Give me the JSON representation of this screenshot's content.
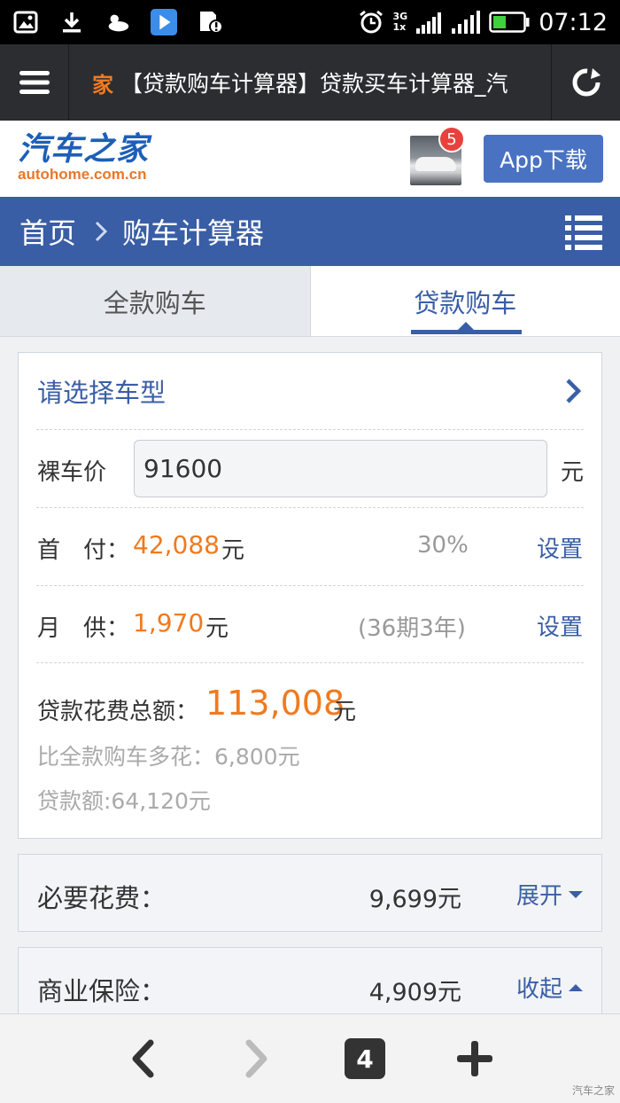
{
  "status_bar": {
    "time": "07:12",
    "network_top": "3G",
    "network_bottom": "1x"
  },
  "browser": {
    "favicon_text": "家",
    "page_title": "【贷款购车计算器】贷款买车计算器_汽"
  },
  "site_header": {
    "logo_cn": "汽车之家",
    "logo_en": "autohome.com.cn",
    "notification_count": "5",
    "app_download_label": "App下载"
  },
  "breadcrumb": {
    "home": "首页",
    "current": "购车计算器"
  },
  "tabs": [
    {
      "label": "全款购车",
      "active": false
    },
    {
      "label": "贷款购车",
      "active": true
    }
  ],
  "calculator": {
    "select_model_label": "请选择车型",
    "bare_price_label": "裸车价",
    "bare_price_value": "91600",
    "currency_unit": "元",
    "down_payment_label": "首　付：",
    "down_payment_value": "42,088",
    "down_payment_percent": "30%",
    "monthly_label": "月　供：",
    "monthly_value": "1,970",
    "monthly_term": "(36期3年)",
    "set_label": "设置",
    "total_label": "贷款花费总额：",
    "total_value": "113,008",
    "extra_cost_text": "比全款购车多花：6,800元",
    "loan_amount_text": "贷款额:64,120元"
  },
  "sections": [
    {
      "label": "必要花费：",
      "value": "9,699元",
      "toggle": "展开",
      "expanded": false
    },
    {
      "label": "商业保险：",
      "value": "4,909元",
      "toggle": "收起",
      "expanded": true
    }
  ],
  "bottom_bar": {
    "tab_count": "4"
  },
  "watermark": "汽车之家",
  "colors": {
    "brand_blue": "#3a5ea6",
    "accent_orange": "#f07a1f",
    "app_button": "#4a72c2"
  }
}
